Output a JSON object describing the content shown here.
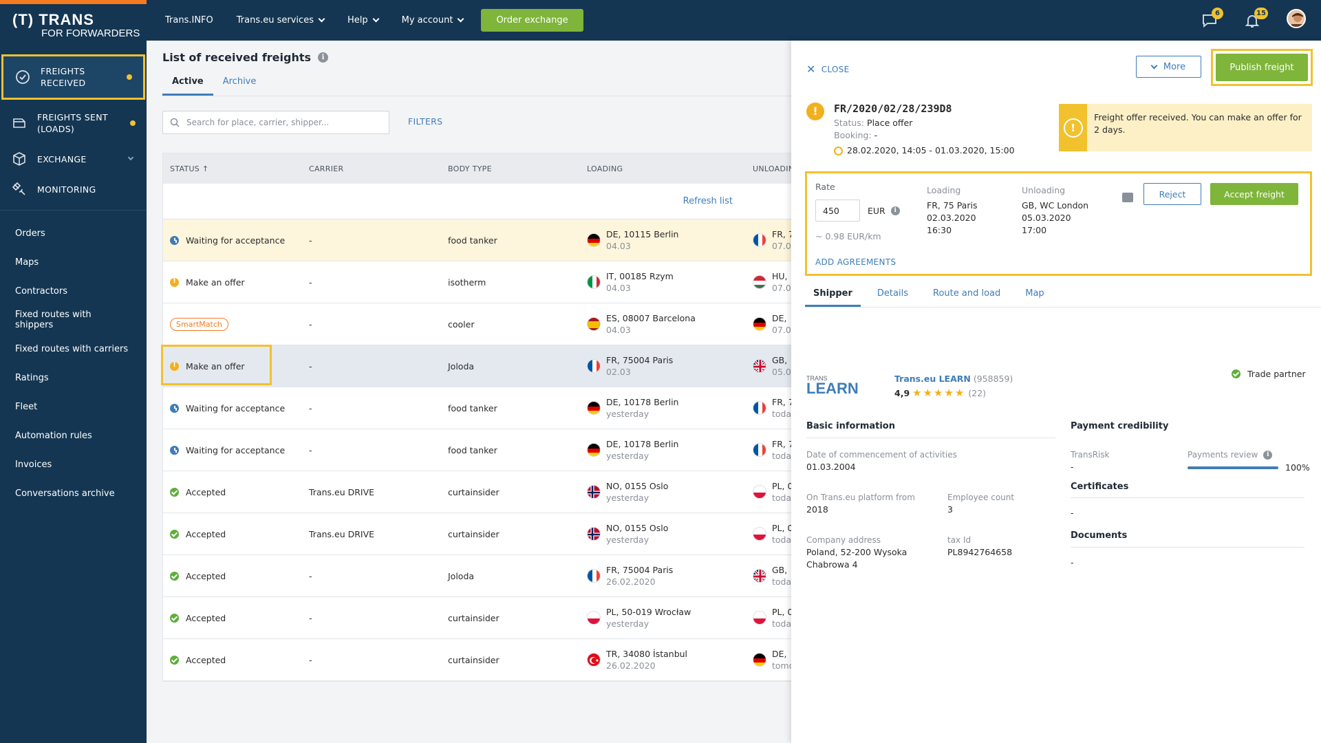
{
  "topbar": {
    "logo_main": "(T) TRANS",
    "logo_for": "FOR",
    "logo_forwarders": "FORWARDERS",
    "nav": [
      {
        "label": "Trans.INFO",
        "dropdown": false
      },
      {
        "label": "Trans.eu services",
        "dropdown": true
      },
      {
        "label": "Help",
        "dropdown": true
      },
      {
        "label": "My account",
        "dropdown": true
      }
    ],
    "order_button": "Order exchange",
    "messages_count": "6",
    "notifications_count": "15"
  },
  "sidebar": {
    "main_items": [
      {
        "label": "FREIGHTS RECEIVED",
        "icon": "freights-received-icon",
        "dot": true
      },
      {
        "label": "FREIGHTS SENT (LOADS)",
        "icon": "freights-sent-icon",
        "dot": true
      },
      {
        "label": "EXCHANGE",
        "icon": "box-icon",
        "dropdown": true
      },
      {
        "label": "MONITORING",
        "icon": "satellite-icon"
      }
    ],
    "sub_items": [
      "Orders",
      "Maps",
      "Contractors",
      "Fixed routes with shippers",
      "Fixed routes with carriers",
      "Ratings",
      "Fleet",
      "Automation rules",
      "Invoices",
      "Conversations archive"
    ]
  },
  "main": {
    "title": "List of received freights",
    "tabs": [
      "Active",
      "Archive"
    ],
    "search_placeholder": "Search for place, carrier, shipper...",
    "filters": "FILTERS",
    "columns": [
      "STATUS ↑",
      "CARRIER",
      "BODY TYPE",
      "LOADING",
      "UNLOADING"
    ],
    "refresh": "Refresh list",
    "rows": [
      {
        "status": "Waiting for acceptance",
        "status_icon": "clock",
        "carrier": "-",
        "body": "food tanker",
        "load_flag": "de",
        "load": "DE, 10115 Berlin",
        "load_date": "04.03",
        "unload_flag": "fr",
        "unload": "FR, 7",
        "unload_date": "07.0"
      },
      {
        "status": "Make an offer",
        "status_icon": "warn",
        "carrier": "-",
        "body": "isotherm",
        "load_flag": "it",
        "load": "IT, 00185 Rzym",
        "load_date": "04.03",
        "unload_flag": "hu",
        "unload": "HU, ",
        "unload_date": "07.0"
      },
      {
        "status": "SmartMatch",
        "status_icon": "smartmatch",
        "carrier": "-",
        "body": "cooler",
        "load_flag": "es",
        "load": "ES, 08007 Barcelona",
        "load_date": "04.03",
        "unload_flag": "de",
        "unload": "DE, ",
        "unload_date": "07.0"
      },
      {
        "status": "Make an offer",
        "status_icon": "warn",
        "carrier": "-",
        "body": "Joloda",
        "load_flag": "fr",
        "load": "FR, 75004 Paris",
        "load_date": "02.03",
        "unload_flag": "gb",
        "unload": "GB, ",
        "unload_date": "05.0"
      },
      {
        "status": "Waiting for acceptance",
        "status_icon": "clock",
        "carrier": "-",
        "body": "food tanker",
        "load_flag": "de",
        "load": "DE, 10178 Berlin",
        "load_date": "yesterday",
        "unload_flag": "fr",
        "unload": "FR, 7",
        "unload_date": "toda"
      },
      {
        "status": "Waiting for acceptance",
        "status_icon": "clock",
        "carrier": "-",
        "body": "food tanker",
        "load_flag": "de",
        "load": "DE, 10178 Berlin",
        "load_date": "yesterday",
        "unload_flag": "fr",
        "unload": "FR, 7",
        "unload_date": "toda"
      },
      {
        "status": "Accepted",
        "status_icon": "ok",
        "carrier": "Trans.eu DRIVE",
        "body": "curtainsider",
        "load_flag": "no",
        "load": "NO, 0155 Oslo",
        "load_date": "yesterday",
        "unload_flag": "pl",
        "unload": "PL, 0",
        "unload_date": "toda"
      },
      {
        "status": "Accepted",
        "status_icon": "ok",
        "carrier": "Trans.eu DRIVE",
        "body": "curtainsider",
        "load_flag": "no",
        "load": "NO, 0155 Oslo",
        "load_date": "yesterday",
        "unload_flag": "pl",
        "unload": "PL, 0",
        "unload_date": "toda"
      },
      {
        "status": "Accepted",
        "status_icon": "ok",
        "carrier": "-",
        "body": "Joloda",
        "load_flag": "fr",
        "load": "FR, 75004 Paris",
        "load_date": "26.02.2020",
        "unload_flag": "gb",
        "unload": "GB, ",
        "unload_date": "toda"
      },
      {
        "status": "Accepted",
        "status_icon": "ok",
        "carrier": "-",
        "body": "curtainsider",
        "load_flag": "pl",
        "load": "PL, 50-019 Wrocław",
        "load_date": "yesterday",
        "unload_flag": "pl",
        "unload": "PL, 0",
        "unload_date": "toda"
      },
      {
        "status": "Accepted",
        "status_icon": "ok",
        "carrier": "-",
        "body": "curtainsider",
        "load_flag": "tr",
        "load": "TR, 34080 İstanbul",
        "load_date": "26.02.2020",
        "unload_flag": "de",
        "unload": "DE, ",
        "unload_date": "tomo"
      }
    ]
  },
  "panel": {
    "close": "CLOSE",
    "more": "More",
    "publish": "Publish freight",
    "freight_id": "FR/2020/02/28/239D8",
    "status_label": "Status:",
    "status_value": "Place offer",
    "booking_label": "Booking:",
    "booking_value": "-",
    "time_range": "28.02.2020, 14:05 - 01.03.2020, 15:00",
    "notice": "Freight offer received. You can make an offer for 2 days.",
    "offer": {
      "rate_label": "Rate",
      "rate_value": "450",
      "currency": "EUR",
      "per_km": "~ 0.98 EUR/km",
      "loading_label": "Loading",
      "loading_place": "FR, 75 Paris",
      "loading_date": "02.03.2020",
      "loading_time": "16:30",
      "unloading_label": "Unloading",
      "unloading_place": "GB, WC London",
      "unloading_date": "05.03.2020",
      "unloading_time": "17:00",
      "reject": "Reject",
      "accept": "Accept freight",
      "add_agreements": "ADD AGREEMENTS"
    },
    "tabs": [
      "Shipper",
      "Details",
      "Route and load",
      "Map"
    ],
    "shipper": {
      "logo_small": "TRANS",
      "logo_big": "LEARN",
      "name": "Trans.eu LEARN",
      "id": "(958859)",
      "rating": "4,9",
      "stars": "★★★★★",
      "reviews": "(22)",
      "trade_partner": "Trade partner",
      "basic_info_title": "Basic information",
      "commencement_label": "Date of commencement of activities",
      "commencement_value": "01.03.2004",
      "platform_label": "On Trans.eu platform from",
      "platform_value": "2018",
      "employee_label": "Employee count",
      "employee_value": "3",
      "address_label": "Company address",
      "address_line1": "Poland, 52-200 Wysoka",
      "address_line2": "Chabrowa 4",
      "tax_label": "tax Id",
      "tax_value": "PL8942764658",
      "payment_title": "Payment credibility",
      "transrisk_label": "TransRisk",
      "transrisk_value": "-",
      "payments_review_label": "Payments review",
      "payments_review_value": "100%",
      "payments_review_fraction": 1.0,
      "certificates_title": "Certificates",
      "certificates_value": "-",
      "documents_title": "Documents",
      "documents_value": "-"
    }
  }
}
